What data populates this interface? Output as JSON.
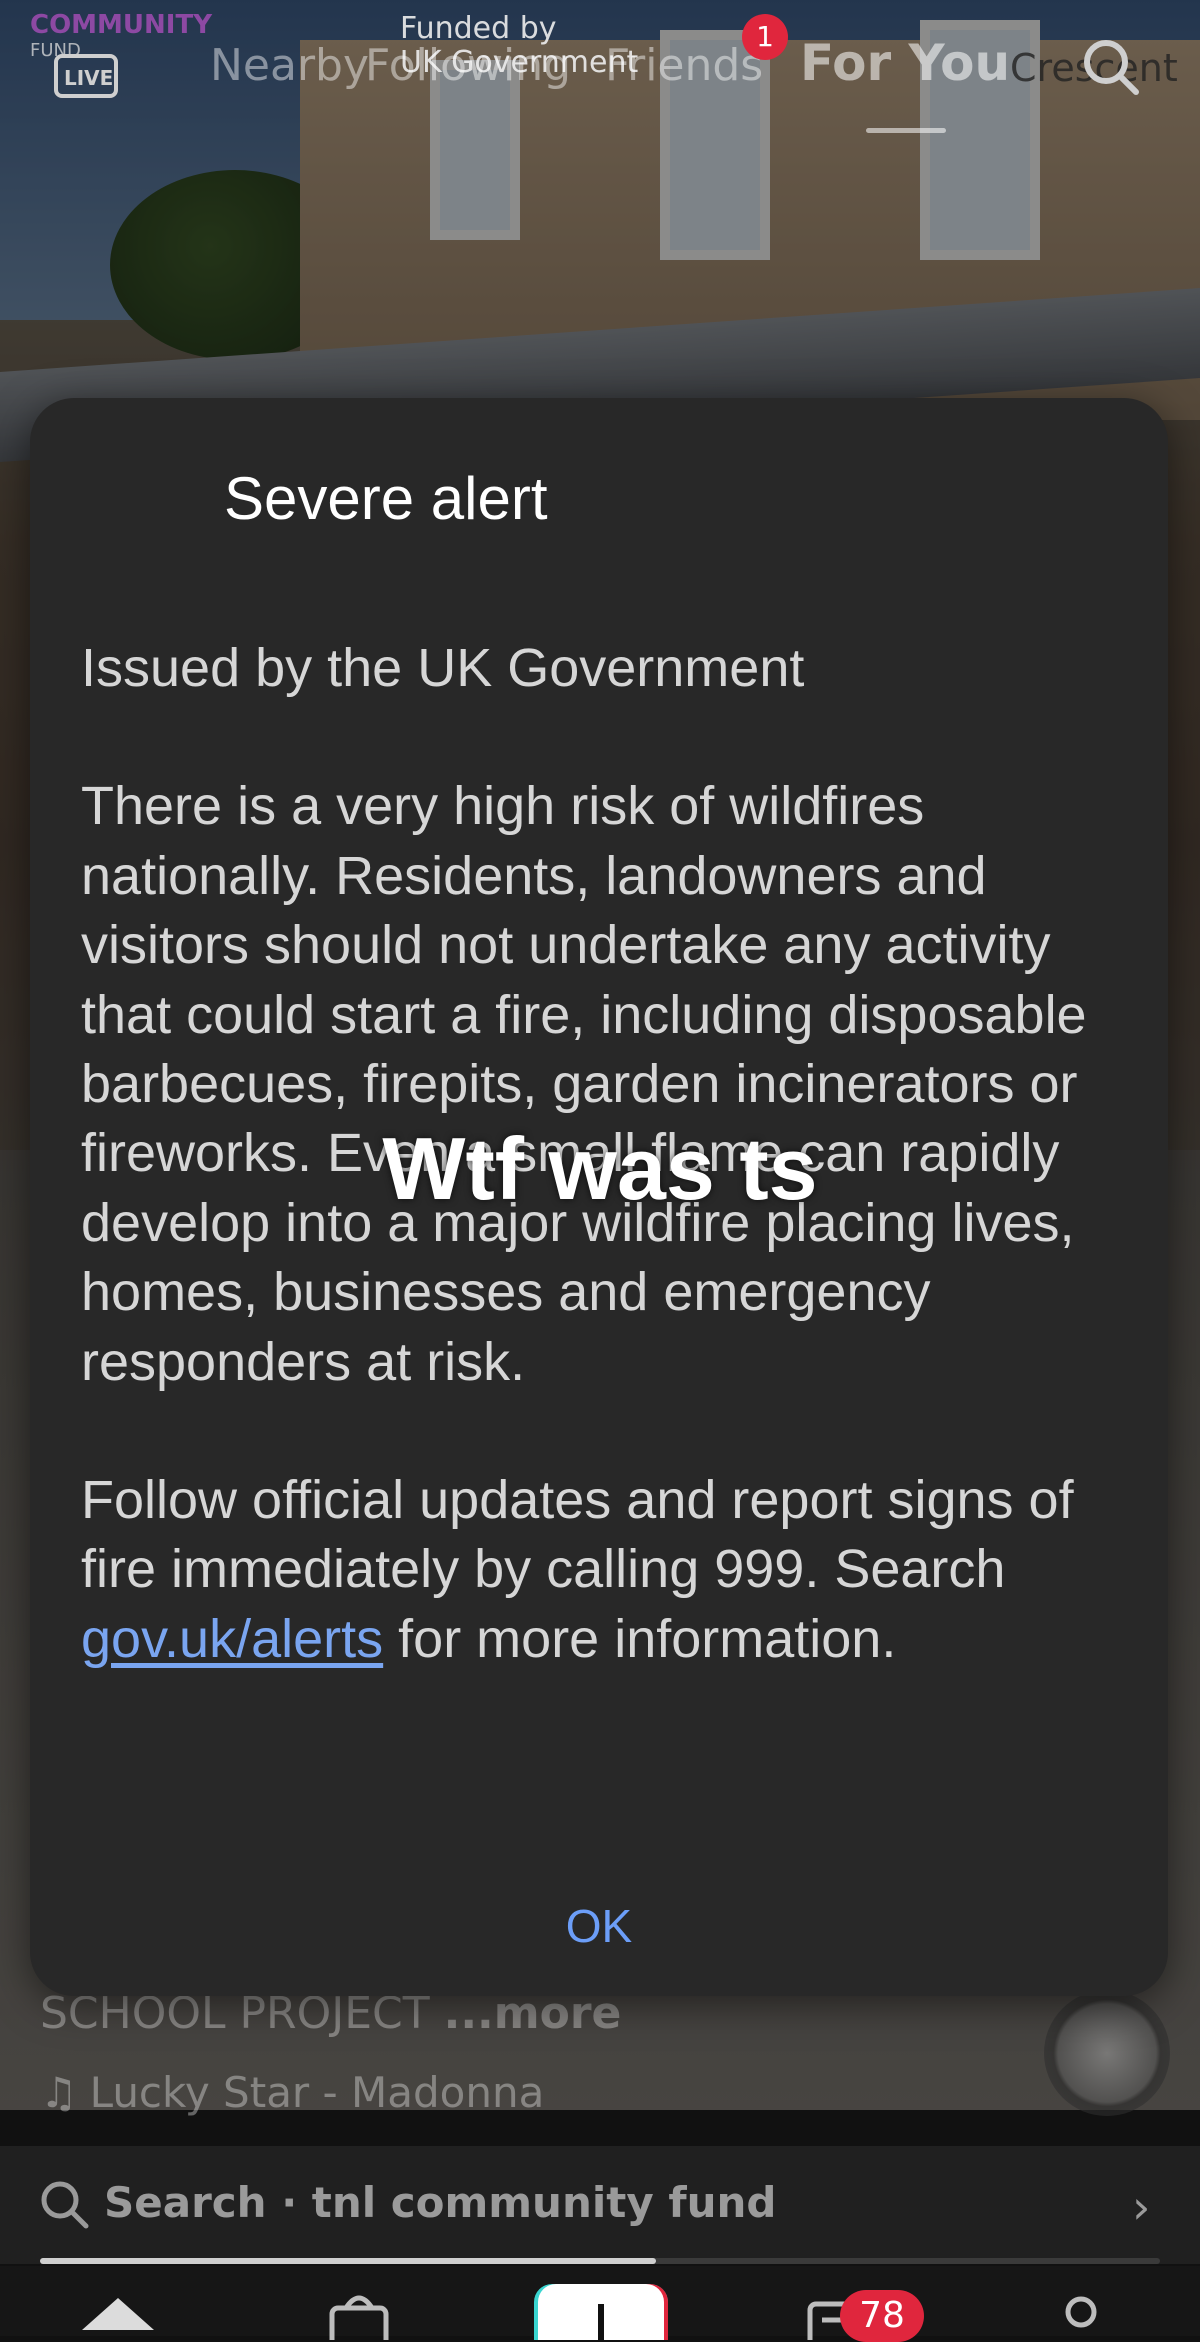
{
  "top_bar": {
    "live_label": "LIVE",
    "tabs": [
      "Nearby",
      "Following",
      "Friends",
      "For You"
    ],
    "active_tab": "For You",
    "notification_count": "1"
  },
  "video_overlays": {
    "community_logo": "COMMUNITY",
    "community_logo_sub": "FUND",
    "funded_by_line1": "Funded by",
    "funded_by_line2": "UK Government",
    "crescent_text": "Crescent"
  },
  "alert_dialog": {
    "title": "Severe alert",
    "issuer": "Issued by the UK Government",
    "paragraph1": "There is a very high risk of wildfires nationally. Residents, landowners and visitors should not undertake any activity that could start a fire, including disposable barbecues, firepits, garden incinerators or fireworks. Even a small flame can rapidly develop into a major wildfire placing lives, homes, businesses and emergency responders at risk.",
    "paragraph2_before_link": "Follow official updates and report signs of fire immediately by calling 999. Search ",
    "link_text": "gov.uk/alerts",
    "paragraph2_after_link": " for more information.",
    "ok_label": "OK"
  },
  "caption": "Wtf was ts",
  "post": {
    "description": "SCHOOL PROJECT",
    "more_label": "...more",
    "music": "Lucky Star - Madonna"
  },
  "search_bar": {
    "text": "Search · tnl community fund",
    "progress": 0.55
  },
  "bottom_nav": {
    "inbox_badge": "78"
  },
  "colors": {
    "dialog_bg": "#282828",
    "accent_blue": "#6c9ef8",
    "badge_red": "#e0263d"
  }
}
